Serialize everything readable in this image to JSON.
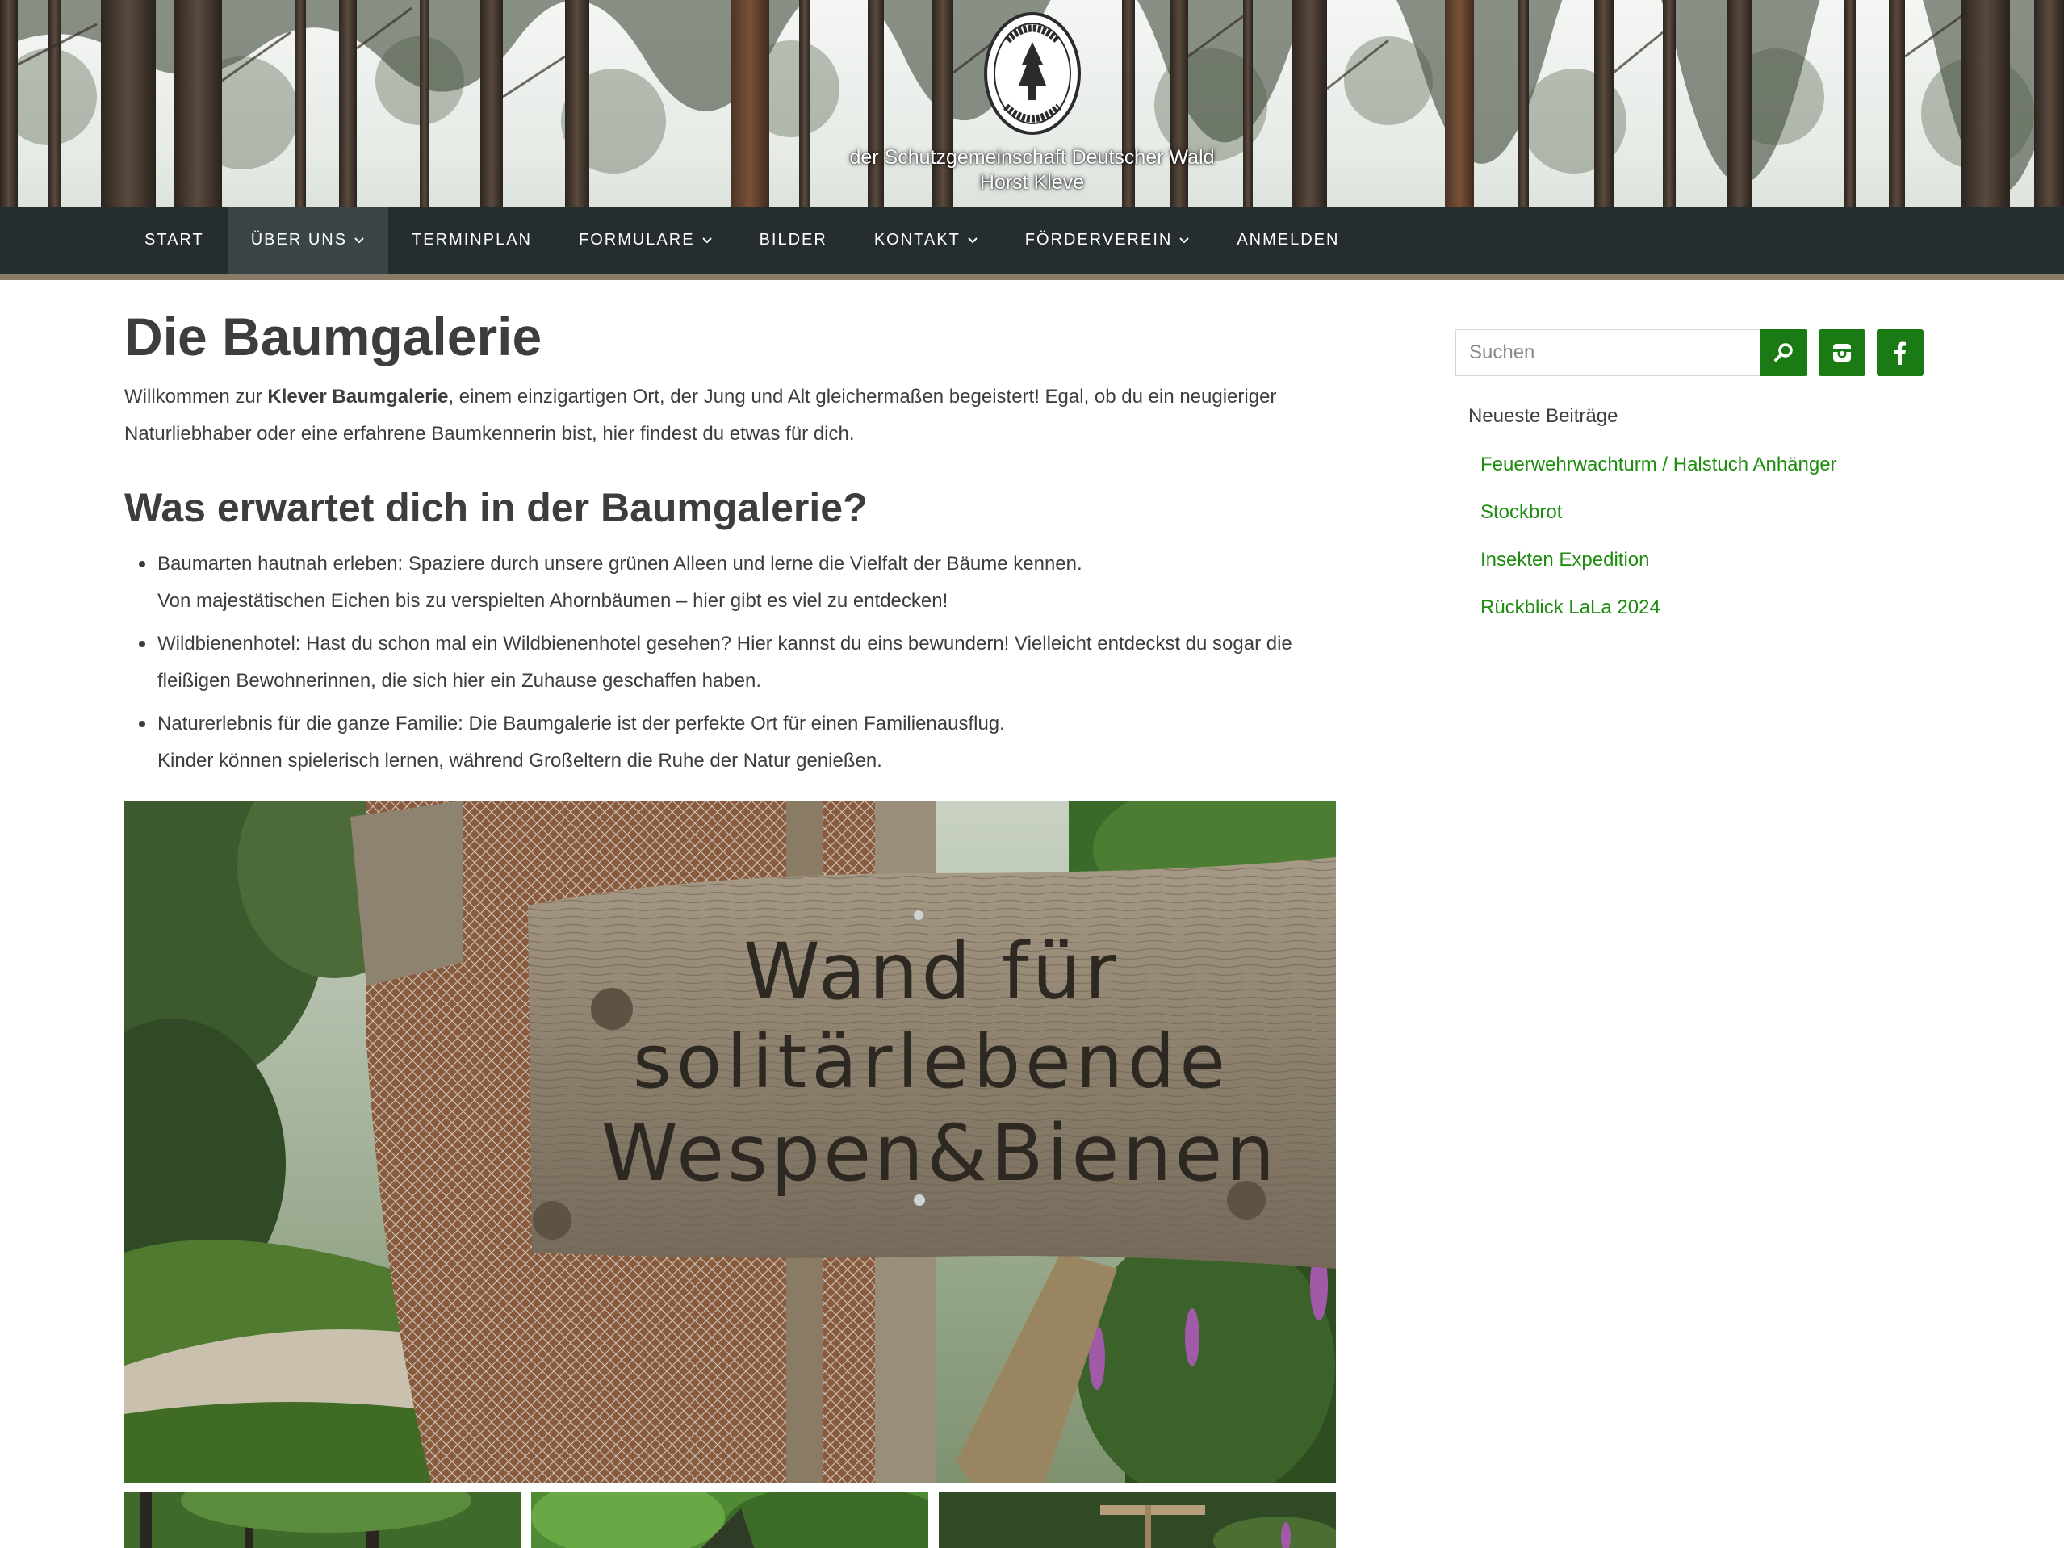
{
  "header": {
    "logo_text": "DEUTSCHE WALDJUGEND",
    "slogan_line1": "der Schutzgemeinschaft Deutscher Wald",
    "slogan_line2": "Horst Kleve"
  },
  "nav": {
    "items": [
      {
        "label": "START",
        "has_dropdown": false
      },
      {
        "label": "ÜBER UNS",
        "has_dropdown": true,
        "active": true
      },
      {
        "label": "TERMINPLAN",
        "has_dropdown": false
      },
      {
        "label": "FORMULARE",
        "has_dropdown": true
      },
      {
        "label": "BILDER",
        "has_dropdown": false
      },
      {
        "label": "KONTAKT",
        "has_dropdown": true
      },
      {
        "label": "FÖRDERVEREIN",
        "has_dropdown": true
      },
      {
        "label": "ANMELDEN",
        "has_dropdown": false
      }
    ]
  },
  "main": {
    "title": "Die Baumgalerie",
    "intro": {
      "before": "Willkommen zur ",
      "bold": "Klever Baumgalerie",
      "after_line1": ", einem einzigartigen Ort, der Jung und Alt gleichermaßen begeistert! Egal, ob du ein neugieriger",
      "line2": "Naturliebhaber oder eine erfahrene Baumkennerin bist, hier findest du etwas für dich."
    },
    "subheading": "Was erwartet dich in der Baumgalerie?",
    "bullets": [
      {
        "line1": "Baumarten hautnah erleben: Spaziere durch unsere grünen Alleen und lerne die Vielfalt der Bäume kennen.",
        "line2": "Von majestätischen Eichen bis zu verspielten Ahornbäumen – hier gibt es viel zu entdecken!"
      },
      {
        "line1": "Wildbienenhotel: Hast du schon mal ein Wildbienenhotel gesehen? Hier kannst du eins bewundern! Vielleicht entdeckst du sogar die",
        "line2": "fleißigen Bewohnerinnen, die sich hier ein Zuhause geschaffen haben."
      },
      {
        "line1": "Naturerlebnis für die ganze Familie: Die Baumgalerie ist der perfekte Ort für einen Familienausflug.",
        "line2": "Kinder können spielerisch lernen, während Großeltern die Ruhe der Natur genießen."
      }
    ],
    "hero_sign": {
      "line1": "Wand für",
      "line2": "solitärlebende",
      "line3": "Wespen&Bienen"
    }
  },
  "sidebar": {
    "search_placeholder": "Suchen",
    "recent_title": "Neueste Beiträge",
    "recent_posts": [
      "Feuerwehrwachturm / Halstuch Anhänger",
      "Stockbrot",
      "Insekten Expedition",
      "Rückblick LaLa 2024"
    ]
  },
  "colors": {
    "nav_bg": "#252d2f",
    "nav_active_bg": "#3b4446",
    "accent_green": "#1a7a14",
    "link_green": "#1e8c0f",
    "text": "#3d3d3d"
  },
  "icons": [
    "search-icon",
    "instagram-icon",
    "facebook-icon",
    "chevron-down-icon",
    "logo-tree-icon"
  ]
}
